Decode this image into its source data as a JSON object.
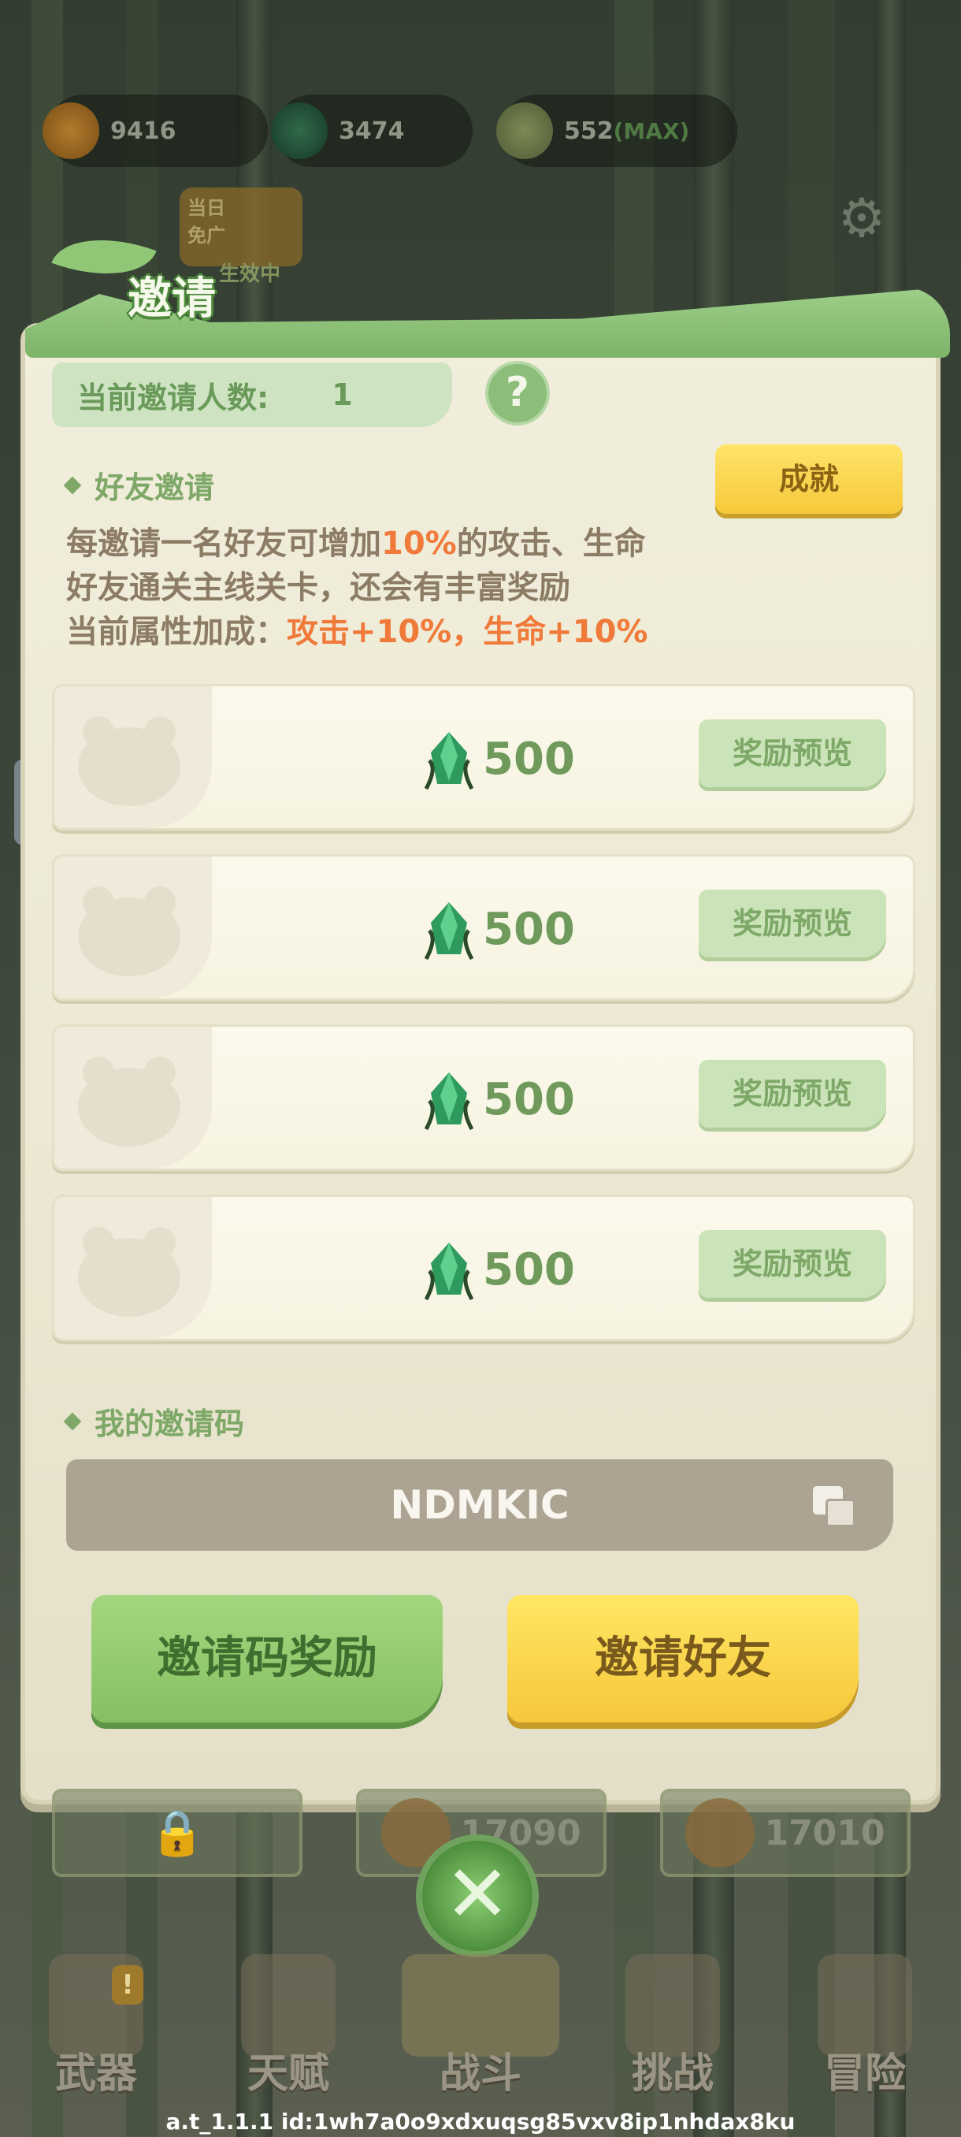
{
  "currencies": [
    {
      "icon": "paw-coin-icon",
      "value": "9416",
      "max": ""
    },
    {
      "icon": "bamboo-gem-icon",
      "value": "3474",
      "max": ""
    },
    {
      "icon": "bamboo-shoot-icon",
      "value": "552",
      "max": "(MAX)"
    }
  ],
  "daily_badge": {
    "line1": "当日",
    "line2": "免广",
    "status": "生效中"
  },
  "settings": {
    "icon": "gear-icon"
  },
  "dialog": {
    "title": "邀请",
    "invite_count_label": "当前邀请人数:",
    "invite_count_value": "1",
    "help_label": "?",
    "friend_invite_title": "好友邀请",
    "achievement_button": "成就",
    "desc_line1_pre": "每邀请一名好友可增加",
    "desc_line1_hl": "10%",
    "desc_line1_post": "的攻击、生命",
    "desc_line2": "好友通关主线关卡，还会有丰富奖励",
    "desc_line3_pre": "当前属性加成：",
    "desc_line3_hl": "攻击+10%，生命+10%",
    "rewards": [
      {
        "value": "500",
        "button": "奖励预览"
      },
      {
        "value": "500",
        "button": "奖励预览"
      },
      {
        "value": "500",
        "button": "奖励预览"
      },
      {
        "value": "500",
        "button": "奖励预览"
      }
    ],
    "my_code_title": "我的邀请码",
    "invite_code": "NDMKIC",
    "code_reward_button": "邀请码奖励",
    "invite_friend_button": "邀请好友"
  },
  "behind_slots": [
    {
      "type": "locked",
      "value": ""
    },
    {
      "type": "coin",
      "value": "17090"
    },
    {
      "type": "coin",
      "value": "17010"
    }
  ],
  "close_label": "✕",
  "nav": [
    {
      "label": "武器",
      "icon": "axe-icon",
      "alert": "!"
    },
    {
      "label": "天赋",
      "icon": "book-icon",
      "alert": ""
    },
    {
      "label": "战斗",
      "icon": "scroll-icon",
      "alert": ""
    },
    {
      "label": "挑战",
      "icon": "stump-icon",
      "alert": ""
    },
    {
      "label": "冒险",
      "icon": "map-icon",
      "alert": ""
    }
  ],
  "footer_id": "a.t_1.1.1 id:1wh7a0o9xdxuqsg85vxv8ip1nhdax8ku",
  "side_toggle": "◑",
  "colors": {
    "accent_green": "#7ea868",
    "highlight_orange": "#f07a3a",
    "button_yellow": "#f6c93a",
    "code_box": "#ada393"
  }
}
